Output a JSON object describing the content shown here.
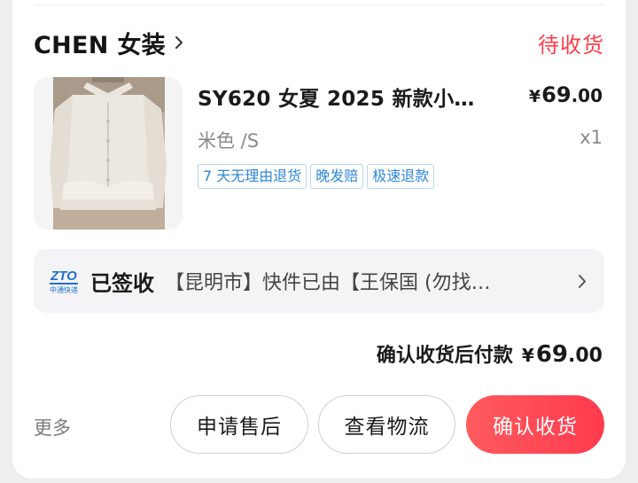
{
  "shop": {
    "name": "CHEN 女装",
    "status": "待收货"
  },
  "product": {
    "title": "SY620 女夏 2025 新款小…",
    "price_symbol": "¥",
    "price_int": "69",
    "price_dec": ".00",
    "variant": "米色 /S",
    "quantity": "x1",
    "tags": [
      "7 天无理由退货",
      "晚发赔",
      "极速退款"
    ]
  },
  "logistics": {
    "carrier_logo_text": "ZTO",
    "carrier_logo_sub": "中通快递",
    "status": "已签收",
    "detail": "【昆明市】快件已由【王保国 (勿找…"
  },
  "payment": {
    "label": "确认收货后付款",
    "amount_symbol": "¥",
    "amount_int": "69",
    "amount_dec": ".00"
  },
  "actions": {
    "more": "更多",
    "after_sale": "申请售后",
    "view_logistics": "查看物流",
    "confirm_receipt": "确认收货"
  },
  "colors": {
    "accent": "#ff3d4a",
    "tag_blue": "#2e86d9",
    "carrier_blue": "#1e6fd0"
  }
}
